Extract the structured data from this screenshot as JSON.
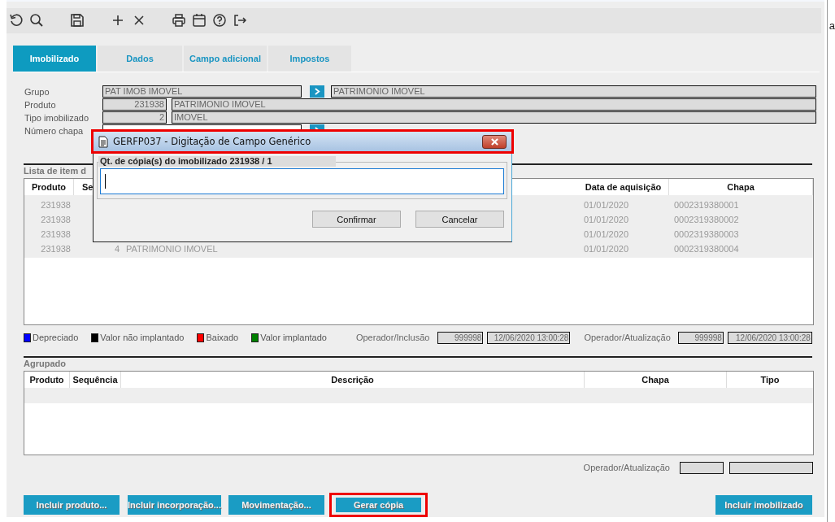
{
  "tabs": [
    {
      "label": "Imobilizado",
      "selected": true
    },
    {
      "label": "Dados",
      "selected": false
    },
    {
      "label": "Campo adicional",
      "selected": false
    },
    {
      "label": "Impostos",
      "selected": false
    }
  ],
  "form": {
    "grupo": {
      "label": "Grupo",
      "code": "PAT IMOB IMOVEL",
      "description": "PATRIMONIO IMOVEL"
    },
    "produto": {
      "label": "Produto",
      "code": "231938",
      "description": "PATRIMONIO IMOVEL"
    },
    "tipo": {
      "label": "Tipo imobilizado",
      "code": "2",
      "description": "IMOVEL"
    },
    "chapa": {
      "label": "Número chapa"
    }
  },
  "items": {
    "title": "Lista de item d",
    "columns": [
      "Produto",
      "Se",
      "Data de aquisição",
      "Chapa"
    ],
    "rows": [
      {
        "produto": "231938",
        "data": "01/01/2020",
        "chapa": "0002319380001"
      },
      {
        "produto": "231938",
        "data": "01/01/2020",
        "chapa": "0002319380002"
      },
      {
        "produto": "231938",
        "data": "01/01/2020",
        "chapa": "0002319380003"
      },
      {
        "produto": "231938",
        "sequencia": "4",
        "descricao": "PATRIMONIO IMOVEL",
        "data": "01/01/2020",
        "chapa": "0002319380004"
      }
    ]
  },
  "legend": [
    {
      "label": "Depreciado",
      "color": "#0000ff"
    },
    {
      "label": "Valor não implantado",
      "color": "#000000"
    },
    {
      "label": "Baixado",
      "color": "#ff0000"
    },
    {
      "label": "Valor implantado",
      "color": "#008000"
    }
  ],
  "inclusao": {
    "label": "Operador/Inclusão",
    "operator": "999998",
    "datetime": "12/06/2020 13:00:28"
  },
  "atualizacao": {
    "label": "Operador/Atualização",
    "operator": "999998",
    "datetime": "12/06/2020 13:00:28"
  },
  "agrupado": {
    "title": "Agrupado",
    "columns": [
      "Produto",
      "Sequência",
      "Descrição",
      "Chapa",
      "Tipo"
    ]
  },
  "bottom_atualizacao": {
    "label": "Operador/Atualização"
  },
  "buttons": [
    {
      "label": "Incluir produto...",
      "highlighted": false
    },
    {
      "label": "Incluir incorporação...",
      "highlighted": false
    },
    {
      "label": "Movimentação...",
      "highlighted": false
    },
    {
      "label": "Gerar cópia",
      "highlighted": true
    }
  ],
  "right_buttons": [
    {
      "label": "Incluir imobilizado",
      "highlighted": false
    }
  ],
  "dialog": {
    "title": "GERFP037 - Digitação de Campo Genérico",
    "highlighted": true,
    "field_label": "Qt. de cópia(s) do imobilizado 231938 / 1",
    "buttons": [
      "Confirmar",
      "Cancelar"
    ]
  },
  "side_text": "a"
}
